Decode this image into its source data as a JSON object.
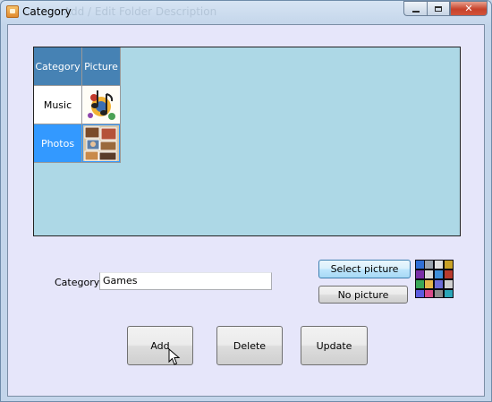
{
  "window": {
    "title": "Category",
    "ghost_title": "Add / Edit Folder Description",
    "icon": "app-icon",
    "controls": [
      "minimize-icon",
      "maximize-icon",
      "close-icon"
    ]
  },
  "grid": {
    "columns": [
      "Category",
      "Picture"
    ],
    "rows": [
      {
        "category": "Music",
        "picture": "music-notes-icon",
        "selected": false
      },
      {
        "category": "Photos",
        "picture": "photo-collage-icon",
        "selected": true
      }
    ],
    "colors": {
      "header": "#4682b4",
      "background": "#add8e6",
      "selected": "#3399ff"
    }
  },
  "form": {
    "category_label": "Category:",
    "category_value": "Games"
  },
  "buttons": {
    "select_picture": "Select picture",
    "no_picture": "No picture",
    "add": "Add",
    "delete": "Delete",
    "update": "Update"
  },
  "preview": {
    "picture": "games-icon-collage"
  }
}
